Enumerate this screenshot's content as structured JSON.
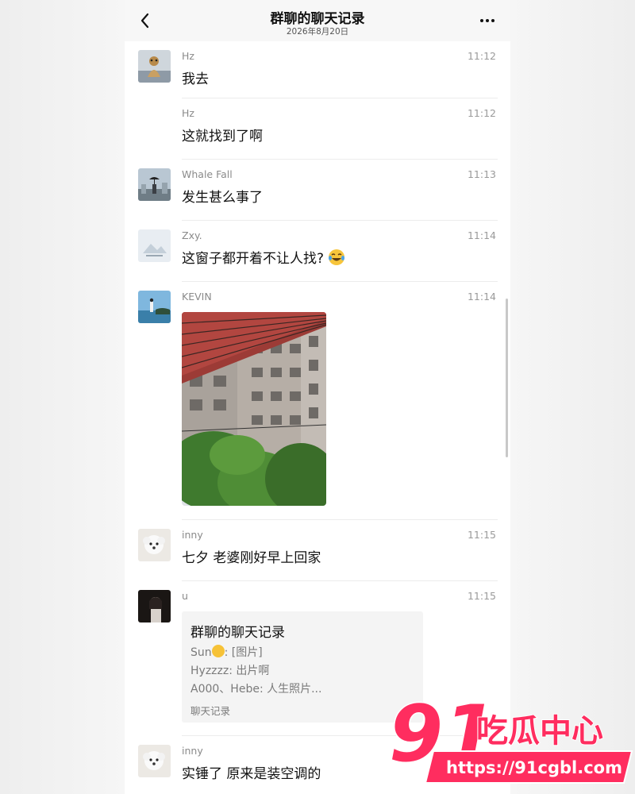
{
  "header": {
    "title": "群聊的聊天记录",
    "date": "2026年8月20日"
  },
  "messages": [
    {
      "sender": "Hz",
      "time": "11:12",
      "text": "我去"
    },
    {
      "sender": "Hz",
      "time": "11:12",
      "text": "这就找到了啊"
    },
    {
      "sender": "Whale Fall",
      "time": "11:13",
      "text": "发生甚么事了"
    },
    {
      "sender": "Zxy.",
      "time": "11:14",
      "text": "这窗子都开着不让人找?"
    },
    {
      "sender": "KEVIN",
      "time": "11:14"
    },
    {
      "sender": "inny",
      "time": "11:15",
      "text": "七夕 老婆刚好早上回家"
    },
    {
      "sender": "u",
      "time": "11:15"
    },
    {
      "sender": "inny",
      "time": "11:15",
      "text": "实锤了 原来是装空调的"
    }
  ],
  "card": {
    "title": "群聊的聊天记录",
    "line1_name": "Sun",
    "line1_rest": ": [图片]",
    "line2": "Hyzzzz: 出片啊",
    "line3": "A000、Hebe: 人生照片...",
    "footer": "聊天记录"
  },
  "watermark": {
    "number": "91",
    "brand": "吃瓜中心",
    "url": "https://91cgbl.com"
  },
  "colors": {
    "watermark_pink": "#ff2d5f",
    "chat_background": "#ffffff",
    "header_background": "#f7f7f7"
  },
  "icons": {
    "back": "chevron-left-icon",
    "more": "more-dots-icon",
    "emoji_laugh": "tears-of-joy-emoji",
    "emoji_smile": "smile-emoji"
  }
}
